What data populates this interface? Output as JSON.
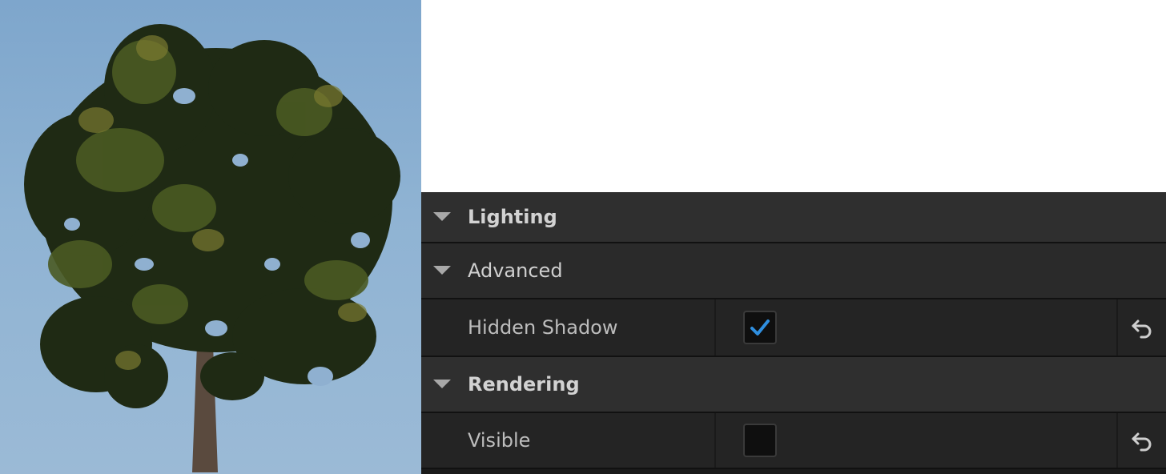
{
  "viewport": {
    "subject": "tree"
  },
  "details": {
    "rows": [
      {
        "type": "category",
        "label": "Lighting"
      },
      {
        "type": "subcategory",
        "label": "Advanced"
      },
      {
        "type": "property",
        "label": "Hidden Shadow",
        "checked": true
      },
      {
        "type": "category",
        "label": "Rendering"
      },
      {
        "type": "property",
        "label": "Visible",
        "checked": false
      }
    ],
    "icons": {
      "expand": "triangle-down-icon",
      "reset": "reset-to-default-icon",
      "check": "checkmark-icon"
    },
    "colors": {
      "check_accent": "#2f8fe0",
      "panel_bg": "#242424"
    }
  }
}
